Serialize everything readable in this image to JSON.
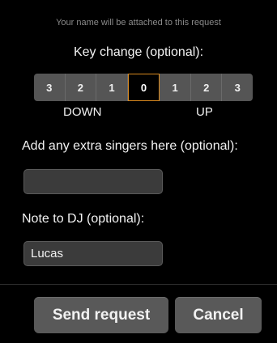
{
  "notice": "Your name will be attached to this request",
  "key_change": {
    "title": "Key change (optional):",
    "options": [
      "3",
      "2",
      "1",
      "0",
      "1",
      "2",
      "3"
    ],
    "selected_index": 3,
    "down_label": "DOWN",
    "up_label": "UP",
    "selected_border_color": "#d98a1f"
  },
  "extra_singers": {
    "label": "Add any extra singers here (optional):",
    "value": ""
  },
  "note_to_dj": {
    "label": "Note to DJ (optional):",
    "value": "Lucas"
  },
  "buttons": {
    "send": "Send request",
    "cancel": "Cancel"
  }
}
